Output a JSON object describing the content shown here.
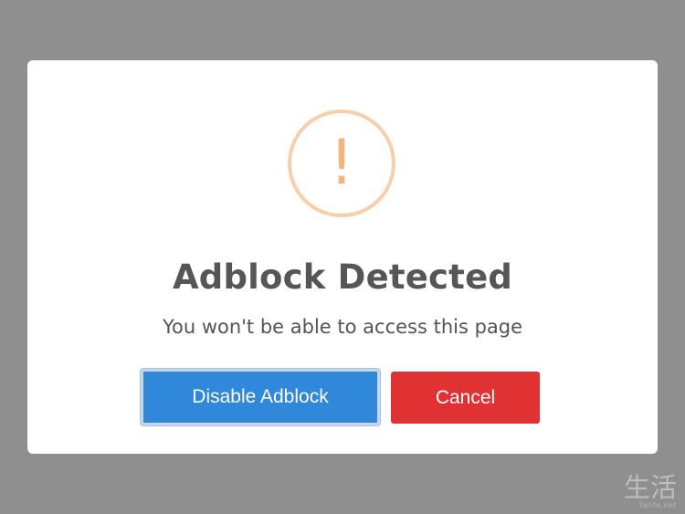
{
  "overlay": {
    "background": "#8f8f8f"
  },
  "dialog": {
    "icon": "exclamation-warning-icon",
    "icon_symbol": "!",
    "title": "Adblock Detected",
    "message": "You won't be able to access this page",
    "primary_button": "Disable Adblock",
    "secondary_button": "Cancel",
    "colors": {
      "primary": "#2f88da",
      "danger": "#e03233",
      "warning": "#f5b57f"
    }
  },
  "watermark": {
    "logo_text": "生活",
    "site": "3elife.net"
  }
}
